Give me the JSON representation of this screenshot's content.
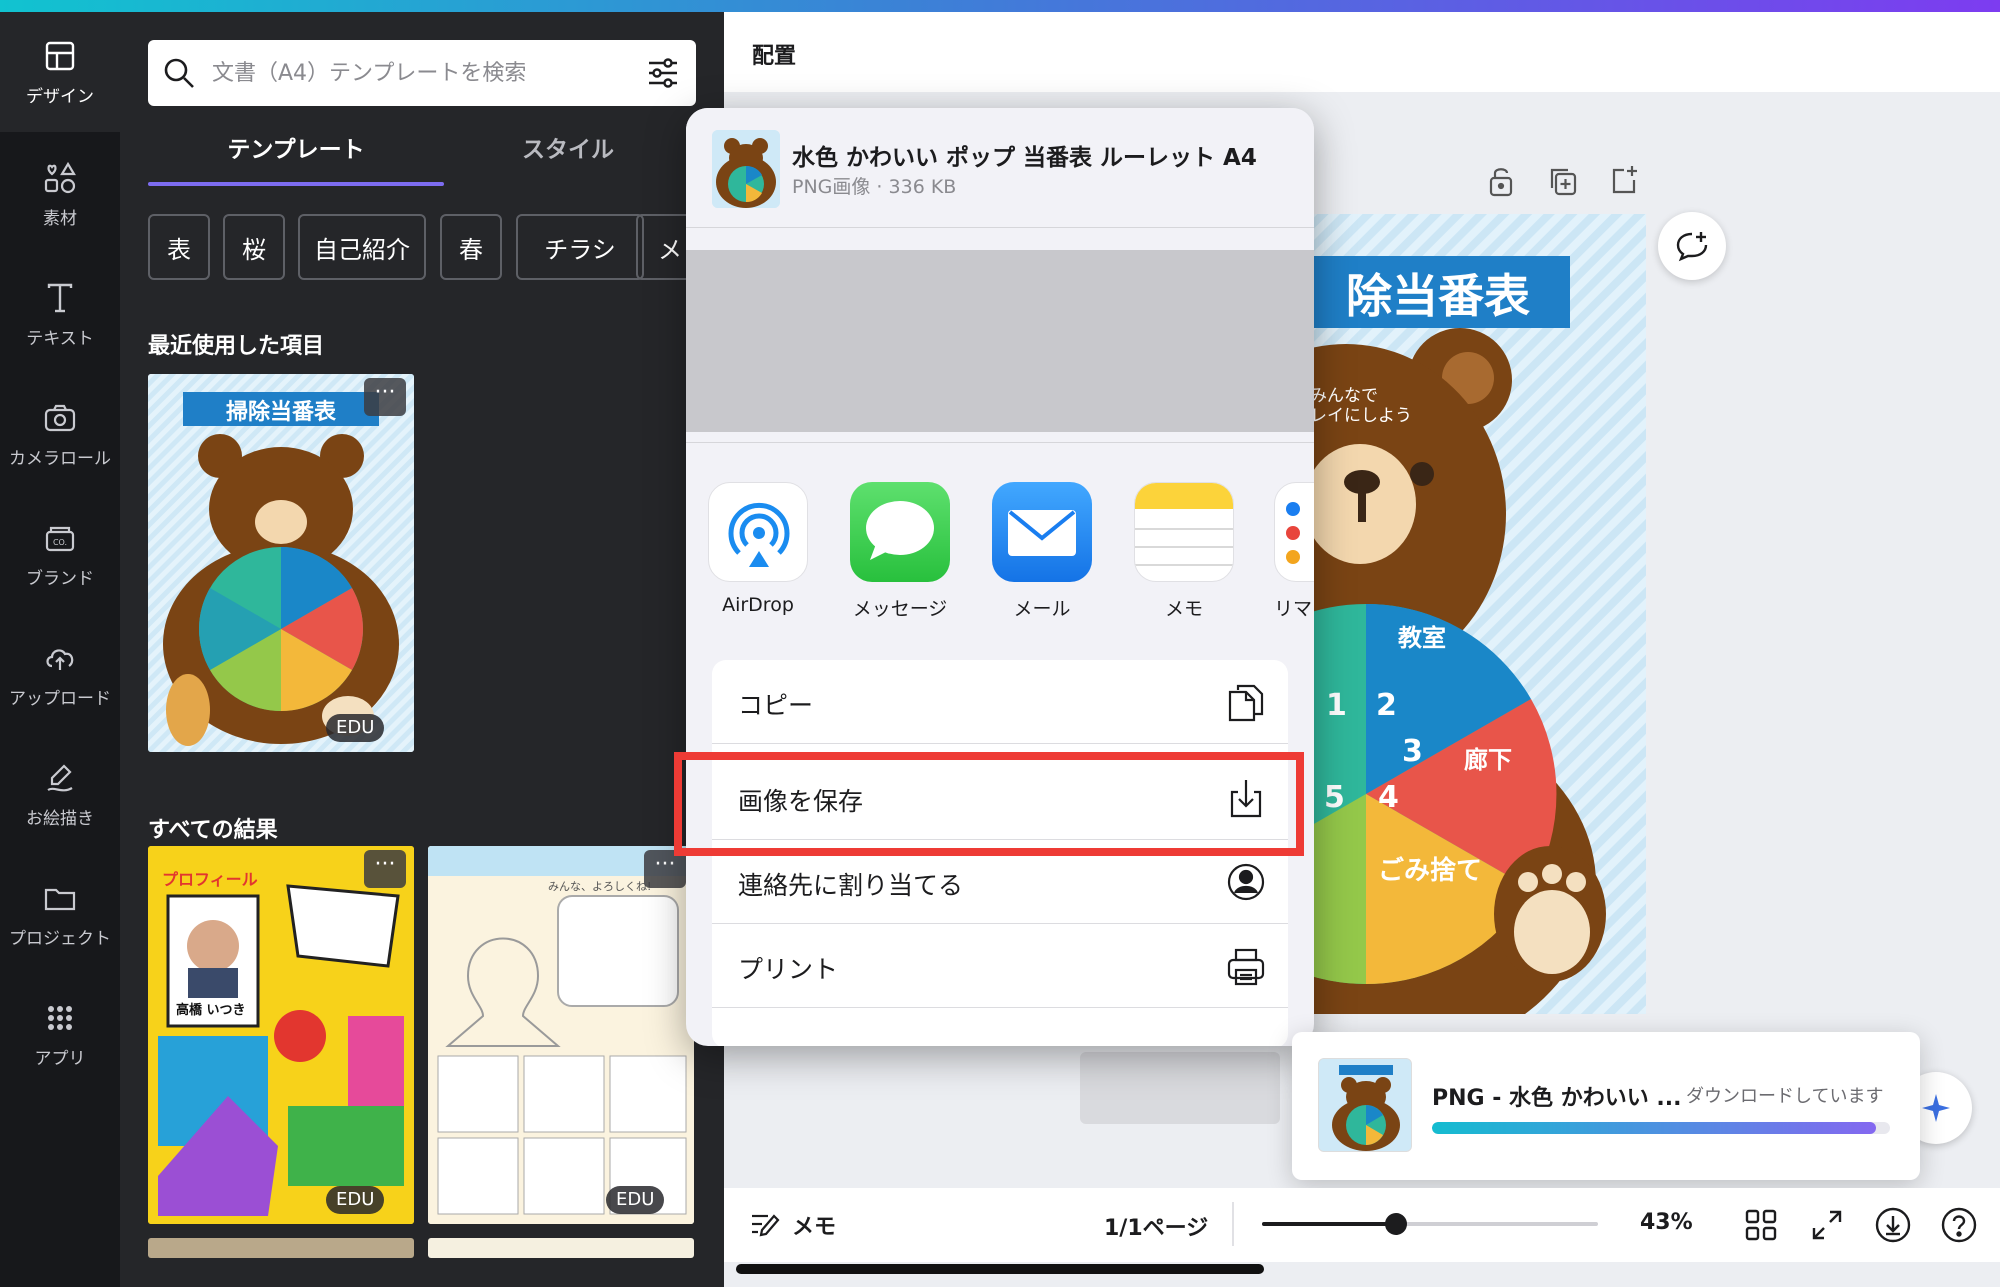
{
  "rail": {
    "items": [
      {
        "label": "デザイン",
        "icon": "layout-icon"
      },
      {
        "label": "素材",
        "icon": "shapes-icon"
      },
      {
        "label": "テキスト",
        "icon": "text-icon"
      },
      {
        "label": "カメラロール",
        "icon": "camera-icon"
      },
      {
        "label": "ブランド",
        "icon": "brand-icon"
      },
      {
        "label": "アップロード",
        "icon": "upload-cloud-icon"
      },
      {
        "label": "お絵描き",
        "icon": "draw-icon"
      },
      {
        "label": "プロジェクト",
        "icon": "folder-icon"
      },
      {
        "label": "アプリ",
        "icon": "apps-grid-icon"
      }
    ]
  },
  "panel": {
    "search_placeholder": "文書（A4）テンプレートを検索",
    "tabs": [
      "テンプレート",
      "スタイル"
    ],
    "chips": [
      "表",
      "桜",
      "自己紹介",
      "春",
      "チラシ",
      "メ"
    ],
    "recent_title": "最近使用した項目",
    "recent_thumb": {
      "title": "掃除当番表",
      "badge": "EDU"
    },
    "all_results_title": "すべての結果",
    "result_badges": [
      "EDU",
      "EDU"
    ],
    "result_thumb_text": {
      "profile": "プロフィール",
      "name": "高橋 いつき",
      "greeting": "みんな、よろしくね!"
    }
  },
  "canvas": {
    "arrange_label": "配置",
    "design_title": "除当番表",
    "design_bubble": "みんなで\nレイにしよう",
    "segments": [
      "教室",
      "1",
      "2",
      "3",
      "廊下",
      "4",
      "5",
      "ごみ捨て"
    ]
  },
  "share_sheet": {
    "title": "水色 かわいい ポップ 当番表 ルーレット A4",
    "subtitle": "PNG画像 · 336 KB",
    "apps": [
      {
        "label": "AirDrop",
        "icon": "airdrop-icon"
      },
      {
        "label": "メッセージ",
        "icon": "messages-icon"
      },
      {
        "label": "メール",
        "icon": "mail-icon"
      },
      {
        "label": "メモ",
        "icon": "notes-icon"
      },
      {
        "label": "リマ",
        "icon": "reminders-icon"
      }
    ],
    "actions": [
      {
        "label": "コピー",
        "icon": "copy-icon"
      },
      {
        "label": "画像を保存",
        "icon": "save-download-icon"
      },
      {
        "label": "連絡先に割り当てる",
        "icon": "contact-icon"
      },
      {
        "label": "プリント",
        "icon": "printer-icon"
      }
    ]
  },
  "download_toast": {
    "name": "PNG - 水色 かわいい ...",
    "status": "ダウンロードしています",
    "progress": 0.97
  },
  "bottom_bar": {
    "memo": "メモ",
    "pages": "1/1ページ",
    "zoom_value": "43%",
    "zoom_fraction": 0.4
  },
  "colors": {
    "accent": "#7d6cf0",
    "highlight": "#ee3b35",
    "panel_bg": "#252629"
  }
}
